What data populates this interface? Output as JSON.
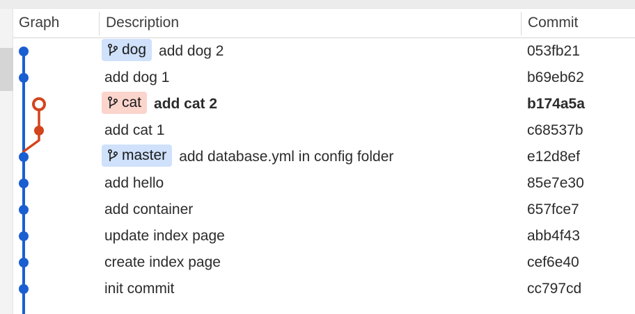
{
  "colors": {
    "master_lane": "#1a5fd1",
    "branch_lane": "#d3441c",
    "badge_blue": "#cfe1fb",
    "badge_red": "#fbd4cc"
  },
  "header": {
    "graph": "Graph",
    "description": "Description",
    "commit": "Commit"
  },
  "rows": [
    {
      "badge": "dog",
      "badge_color": "blue",
      "message": "add dog 2",
      "commit": "053fb21",
      "bold": false,
      "icon": "branch-icon"
    },
    {
      "badge": null,
      "message": "add dog 1",
      "commit": "b69eb62",
      "bold": false
    },
    {
      "badge": "cat",
      "badge_color": "red",
      "message": "add cat 2",
      "commit": "b174a5a",
      "bold": true,
      "icon": "branch-icon"
    },
    {
      "badge": null,
      "message": "add cat 1",
      "commit": "c68537b",
      "bold": false
    },
    {
      "badge": "master",
      "badge_color": "blue",
      "message": "add database.yml in config folder",
      "commit": "e12d8ef",
      "bold": false,
      "icon": "branch-icon"
    },
    {
      "badge": null,
      "message": "add hello",
      "commit": "85e7e30",
      "bold": false
    },
    {
      "badge": null,
      "message": "add container",
      "commit": "657fce7",
      "bold": false
    },
    {
      "badge": null,
      "message": "update index page",
      "commit": "abb4f43",
      "bold": false
    },
    {
      "badge": null,
      "message": "create index page",
      "commit": "cef6e40",
      "bold": false
    },
    {
      "badge": null,
      "message": "init commit",
      "commit": "cc797cd",
      "bold": false
    }
  ]
}
